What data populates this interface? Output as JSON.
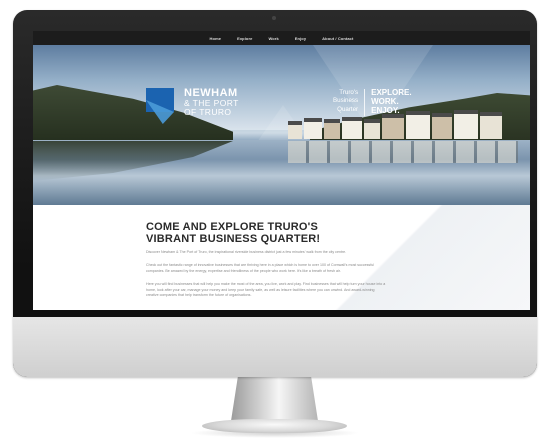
{
  "nav": {
    "items": [
      "Home",
      "Explore",
      "Work",
      "Enjoy",
      "About / Contact"
    ]
  },
  "brand": {
    "line1": "NEWHAM",
    "line2": "& THE PORT",
    "line3": "OF TRURO"
  },
  "tagline": {
    "left": [
      "Truro's",
      "Business",
      "Quarter"
    ],
    "right": [
      "EXPLORE.",
      "WORK.",
      "ENJOY."
    ]
  },
  "content": {
    "headline_line1": "COME AND EXPLORE TRURO'S",
    "headline_line2": "VIBRANT BUSINESS QUARTER!",
    "paragraphs": [
      "Discover Newham & The Port of Truro, the inspirational riverside business district just a few minutes' walk from the city centre.",
      "Check out the fantastic range of innovative businesses that are thriving here in a place which is home to over 100 of Cornwall's most successful companies. Be amazed by the energy, expertise and friendliness of the people who work here. It's like a breath of fresh air.",
      "Here you will find businesses that will help you make the most of the area, you live, work and play. Find businesses that will help turn your house into a home, look after your car, manage your money and keep your family safe, as well as leisure facilities where you can unwind. And award-winning creative companies that help transform the future of organisations."
    ]
  },
  "colors": {
    "nav_bg": "#1c1c1c",
    "brand_blue": "#1b63b0",
    "brand_light_blue": "#4a9ad8",
    "headline": "#2a2a2a"
  }
}
